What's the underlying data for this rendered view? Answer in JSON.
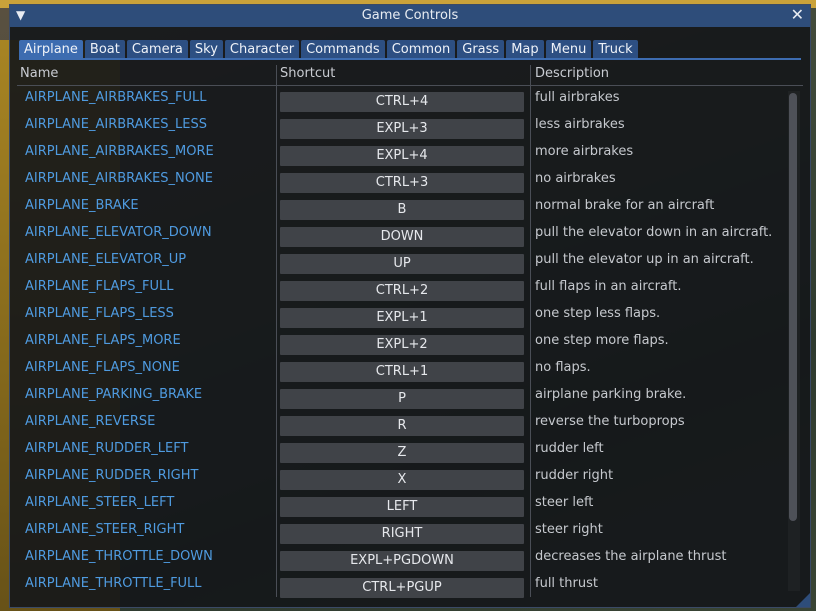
{
  "window": {
    "title": "Game Controls"
  },
  "tabs": [
    "Airplane",
    "Boat",
    "Camera",
    "Sky",
    "Character",
    "Commands",
    "Common",
    "Grass",
    "Map",
    "Menu",
    "Truck"
  ],
  "active_tab": "Airplane",
  "columns": {
    "name": "Name",
    "shortcut": "Shortcut",
    "description": "Description"
  },
  "rows": [
    {
      "name": "AIRPLANE_AIRBRAKES_FULL",
      "key": "CTRL+4",
      "desc": "full airbrakes"
    },
    {
      "name": "AIRPLANE_AIRBRAKES_LESS",
      "key": "EXPL+3",
      "desc": "less airbrakes"
    },
    {
      "name": "AIRPLANE_AIRBRAKES_MORE",
      "key": "EXPL+4",
      "desc": "more airbrakes"
    },
    {
      "name": "AIRPLANE_AIRBRAKES_NONE",
      "key": "CTRL+3",
      "desc": "no airbrakes"
    },
    {
      "name": "AIRPLANE_BRAKE",
      "key": "B",
      "desc": "normal brake for an aircraft"
    },
    {
      "name": "AIRPLANE_ELEVATOR_DOWN",
      "key": "DOWN",
      "desc": "pull the elevator down in an aircraft."
    },
    {
      "name": "AIRPLANE_ELEVATOR_UP",
      "key": "UP",
      "desc": "pull the elevator up in an aircraft."
    },
    {
      "name": "AIRPLANE_FLAPS_FULL",
      "key": "CTRL+2",
      "desc": "full flaps in an aircraft."
    },
    {
      "name": "AIRPLANE_FLAPS_LESS",
      "key": "EXPL+1",
      "desc": "one step less flaps."
    },
    {
      "name": "AIRPLANE_FLAPS_MORE",
      "key": "EXPL+2",
      "desc": "one step more flaps."
    },
    {
      "name": "AIRPLANE_FLAPS_NONE",
      "key": "CTRL+1",
      "desc": "no flaps."
    },
    {
      "name": "AIRPLANE_PARKING_BRAKE",
      "key": "P",
      "desc": "airplane parking brake."
    },
    {
      "name": "AIRPLANE_REVERSE",
      "key": "R",
      "desc": "reverse the turboprops"
    },
    {
      "name": "AIRPLANE_RUDDER_LEFT",
      "key": "Z",
      "desc": "rudder left"
    },
    {
      "name": "AIRPLANE_RUDDER_RIGHT",
      "key": "X",
      "desc": "rudder right"
    },
    {
      "name": "AIRPLANE_STEER_LEFT",
      "key": "LEFT",
      "desc": "steer left"
    },
    {
      "name": "AIRPLANE_STEER_RIGHT",
      "key": "RIGHT",
      "desc": "steer right"
    },
    {
      "name": "AIRPLANE_THROTTLE_DOWN",
      "key": "EXPL+PGDOWN",
      "desc": "decreases the airplane thrust"
    },
    {
      "name": "AIRPLANE_THROTTLE_FULL",
      "key": "CTRL+PGUP",
      "desc": "full thrust"
    }
  ],
  "colors": {
    "title_bar": "#2e4d7a",
    "tab": "#2d4f82",
    "tab_active": "#3d6cb0",
    "name_text": "#4f9be0",
    "key_button": "#404348"
  },
  "icons": {
    "collapse": "triangle-down-icon",
    "close": "close-x-icon"
  }
}
